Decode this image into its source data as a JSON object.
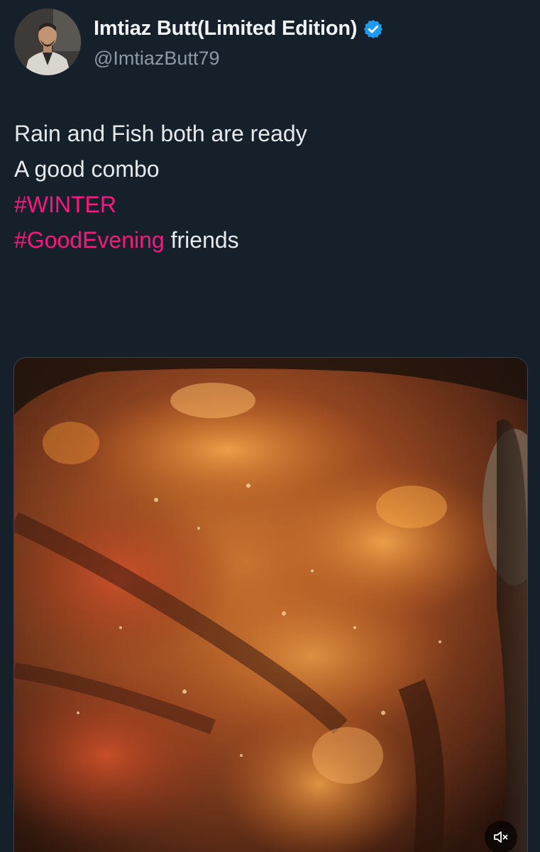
{
  "author": {
    "display_name": "Imtiaz Butt(Limited Edition)",
    "handle": "@ImtiazButt79",
    "verified": true,
    "verified_color": "#1d9bf0"
  },
  "tweet": {
    "line1": "Rain and Fish both are ready",
    "line2": "A good combo",
    "hashtag1": "#WINTER",
    "hashtag2": "#GoodEvening",
    "line4_suffix": " friends",
    "hashtag_color": "#f91880"
  },
  "media": {
    "type": "video",
    "subject": "fried fish",
    "mute_icon": "speaker-muted-icon"
  }
}
